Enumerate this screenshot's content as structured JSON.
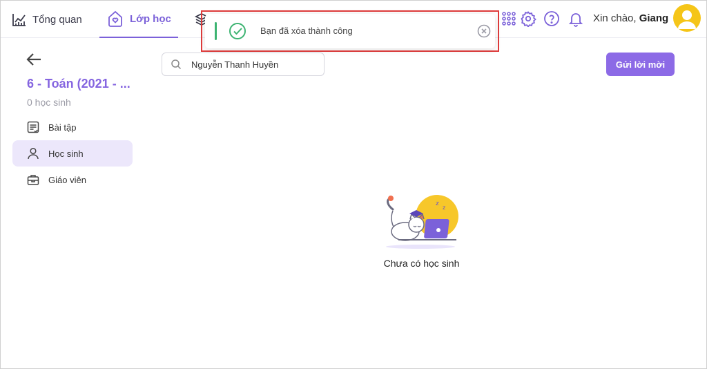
{
  "nav": {
    "overview_label": "Tổng quan",
    "class_label": "Lớp học"
  },
  "header": {
    "greeting_prefix": "Xin chào, ",
    "user_name": "Giang"
  },
  "toast": {
    "message": "Bạn đã xóa thành công"
  },
  "sidebar": {
    "class_title": "6 - Toán (2021 - ...",
    "student_count": "0 học sinh",
    "items": [
      {
        "label": "Bài tập",
        "icon": "assignment-icon"
      },
      {
        "label": "Học sinh",
        "icon": "student-icon",
        "active": true
      },
      {
        "label": "Giáo viên",
        "icon": "teacher-icon"
      }
    ]
  },
  "main": {
    "search_value": "Nguyễn Thanh Huyền",
    "invite_button": "Gửi lời mời",
    "empty_message": "Chưa có học sinh"
  },
  "colors": {
    "accent": "#8c6ae6",
    "success": "#3cb371",
    "highlight_frame": "#e03b3b"
  }
}
